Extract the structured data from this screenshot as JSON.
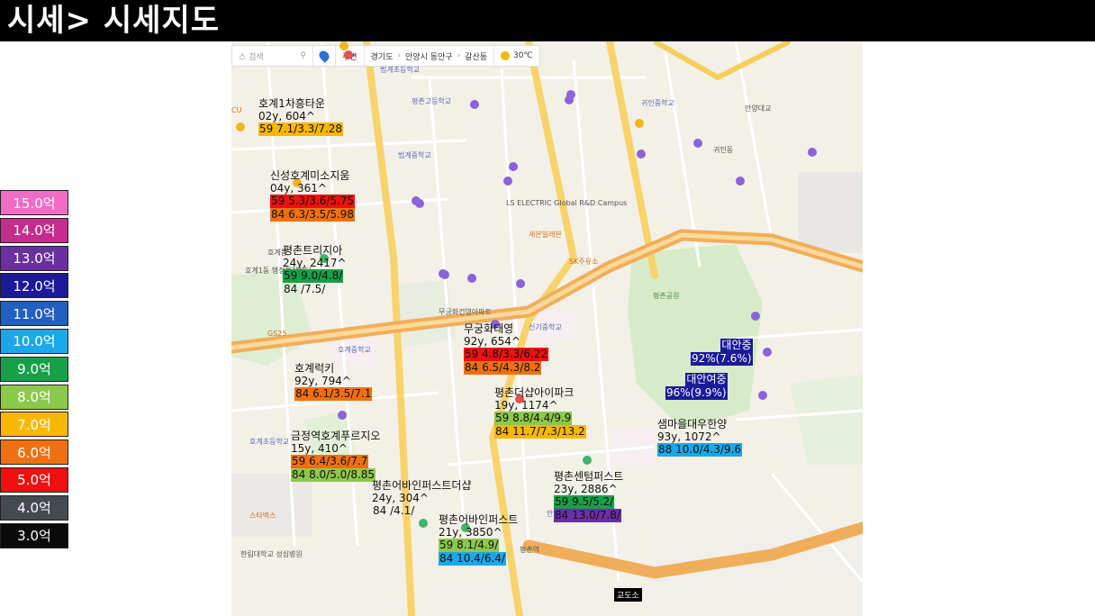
{
  "title": "시세> 시세지도",
  "legend": [
    {
      "label": "15.0억",
      "color": "#f26bc4"
    },
    {
      "label": "14.0억",
      "color": "#c42d8c"
    },
    {
      "label": "13.0억",
      "color": "#6b2fa0"
    },
    {
      "label": "12.0억",
      "color": "#1a1a9a"
    },
    {
      "label": "11.0억",
      "color": "#2060c0"
    },
    {
      "label": "10.0억",
      "color": "#1aa8e8"
    },
    {
      "label": "9.0억",
      "color": "#16a04a"
    },
    {
      "label": "8.0억",
      "color": "#8cc84b"
    },
    {
      "label": "7.0억",
      "color": "#f8b800"
    },
    {
      "label": "6.0억",
      "color": "#f07010"
    },
    {
      "label": "5.0억",
      "color": "#f01010"
    },
    {
      "label": "4.0억",
      "color": "#444a50"
    },
    {
      "label": "3.0억",
      "color": "#0a0a0a"
    }
  ],
  "toolbar": {
    "search_placeholder": "스 검색",
    "mode": "주변",
    "crumbs": [
      "경기도",
      "안양시 동안구",
      "갈산동"
    ],
    "weather": "30℃"
  },
  "stamp": "교도소",
  "annotations": [
    {
      "name": "호계1차흥타운",
      "info": "02y, 604^",
      "rows": [
        {
          "text": "59 7.1/3.3/7.28",
          "color": "#f8b800"
        }
      ]
    },
    {
      "name": "신성호계미소지움",
      "info": "04y, 361^",
      "rows": [
        {
          "text": "59 5.3/3.6/5.75",
          "color": "#f01010"
        },
        {
          "text": "84 6.3/3.5/5.98",
          "color": "#f07010"
        }
      ]
    },
    {
      "name": "평촌트리지아",
      "info": "24y, 2417^",
      "rows": [
        {
          "text": "59 9.0/4.8/",
          "color": "#16a04a"
        },
        {
          "text": "84 /7.5/",
          "color": ""
        }
      ]
    },
    {
      "name": "무궁화태영",
      "info": "92y, 654^",
      "rows": [
        {
          "text": "59 4.8/3.3/6.22",
          "color": "#f01010"
        },
        {
          "text": "84 6.5/4.3/8.2",
          "color": "#f07010"
        }
      ]
    },
    {
      "name": "호계럭키",
      "info": "92y, 794^",
      "rows": [
        {
          "text": "84 6.1/3.5/7.1",
          "color": "#f07010"
        }
      ]
    },
    {
      "name": "평촌더샵아이파크",
      "info": "19y, 1174^",
      "rows": [
        {
          "text": "59 8.8/4.4/9.9",
          "color": "#8cc84b"
        },
        {
          "text": "84 11.7/7.3/13.2",
          "color": "#f8b800"
        }
      ]
    },
    {
      "name": "샘마을대우한양",
      "info": "93y, 1072^",
      "rows": [
        {
          "text": "88 10.0/4.3/9.6",
          "color": "#1aa8e8"
        }
      ]
    },
    {
      "name": "금정역호계푸르지오",
      "info": "15y, 410^",
      "rows": [
        {
          "text": "59 6.4/3.6/7.7",
          "color": "#f07010"
        },
        {
          "text": "84 8.0/5.0/8.85",
          "color": "#8cc84b"
        }
      ]
    },
    {
      "name": "평촌센텀퍼스트",
      "info": "23y, 2886^",
      "rows": [
        {
          "text": "59 9.5/5.2/",
          "color": "#16a04a"
        },
        {
          "text": "84 13.0/7.8/",
          "color": "#6b2fa0"
        }
      ]
    },
    {
      "name": "평촌어바인퍼스트더샵",
      "info": "24y, 304^",
      "rows": [
        {
          "text": "84 /4.1/",
          "color": ""
        }
      ]
    },
    {
      "name": "평촌어바인퍼스트",
      "info": "21y, 3850^",
      "rows": [
        {
          "text": "59 8.1/4.9/",
          "color": "#8cc84b"
        },
        {
          "text": "84 10.4/6.4/",
          "color": "#1aa8e8"
        }
      ]
    }
  ],
  "school_tags": [
    {
      "name": "대안중",
      "info": "92%(7.6%)",
      "color": "#1a1a9a"
    },
    {
      "name": "대안여중",
      "info": "96%(9.9%)",
      "color": "#1a1a9a"
    }
  ],
  "map_labels": [
    {
      "text": "법계초등학교",
      "kind": "blue"
    },
    {
      "text": "평촌고등학교",
      "kind": "blue"
    },
    {
      "text": "귀인중학교",
      "kind": "blue"
    },
    {
      "text": "범계중학교",
      "kind": "blue"
    },
    {
      "text": "신기중학교",
      "kind": "blue"
    },
    {
      "text": "호계중학교",
      "kind": "blue"
    },
    {
      "text": "호계초등학교",
      "kind": "blue"
    },
    {
      "text": "안양초등학교",
      "kind": "blue"
    },
    {
      "text": "평촌공원",
      "kind": "green"
    },
    {
      "text": "귀인동",
      "kind": "dark"
    },
    {
      "text": "호계동",
      "kind": "dark"
    },
    {
      "text": "무궁화건영아파트",
      "kind": "dark"
    },
    {
      "text": "스타벅스",
      "kind": "orange"
    },
    {
      "text": "GS25",
      "kind": "orange"
    },
    {
      "text": "CU",
      "kind": "orange"
    },
    {
      "text": "LS ELECTRIC Global R&D Campus",
      "kind": "dark"
    },
    {
      "text": "한림대학교 성심병원",
      "kind": "dark"
    },
    {
      "text": "안양대교",
      "kind": "dark"
    },
    {
      "text": "평촌역",
      "kind": "dark"
    },
    {
      "text": "호계1동 행정복지센터",
      "kind": "dark"
    },
    {
      "text": "SK주유소",
      "kind": "orange"
    },
    {
      "text": "세븐일레븐",
      "kind": "orange"
    }
  ]
}
